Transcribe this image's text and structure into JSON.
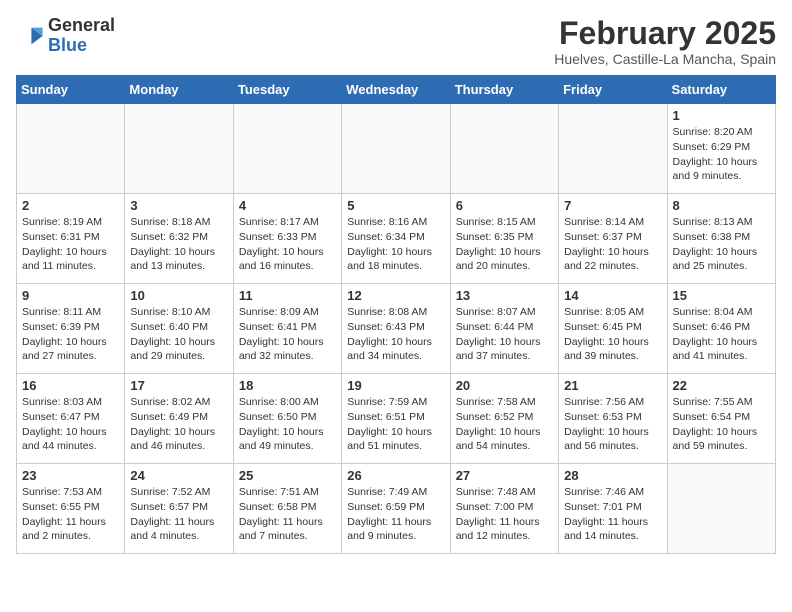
{
  "header": {
    "logo_general": "General",
    "logo_blue": "Blue",
    "month_title": "February 2025",
    "location": "Huelves, Castille-La Mancha, Spain"
  },
  "days_of_week": [
    "Sunday",
    "Monday",
    "Tuesday",
    "Wednesday",
    "Thursday",
    "Friday",
    "Saturday"
  ],
  "weeks": [
    [
      {
        "day": "",
        "info": ""
      },
      {
        "day": "",
        "info": ""
      },
      {
        "day": "",
        "info": ""
      },
      {
        "day": "",
        "info": ""
      },
      {
        "day": "",
        "info": ""
      },
      {
        "day": "",
        "info": ""
      },
      {
        "day": "1",
        "info": "Sunrise: 8:20 AM\nSunset: 6:29 PM\nDaylight: 10 hours and 9 minutes."
      }
    ],
    [
      {
        "day": "2",
        "info": "Sunrise: 8:19 AM\nSunset: 6:31 PM\nDaylight: 10 hours and 11 minutes."
      },
      {
        "day": "3",
        "info": "Sunrise: 8:18 AM\nSunset: 6:32 PM\nDaylight: 10 hours and 13 minutes."
      },
      {
        "day": "4",
        "info": "Sunrise: 8:17 AM\nSunset: 6:33 PM\nDaylight: 10 hours and 16 minutes."
      },
      {
        "day": "5",
        "info": "Sunrise: 8:16 AM\nSunset: 6:34 PM\nDaylight: 10 hours and 18 minutes."
      },
      {
        "day": "6",
        "info": "Sunrise: 8:15 AM\nSunset: 6:35 PM\nDaylight: 10 hours and 20 minutes."
      },
      {
        "day": "7",
        "info": "Sunrise: 8:14 AM\nSunset: 6:37 PM\nDaylight: 10 hours and 22 minutes."
      },
      {
        "day": "8",
        "info": "Sunrise: 8:13 AM\nSunset: 6:38 PM\nDaylight: 10 hours and 25 minutes."
      }
    ],
    [
      {
        "day": "9",
        "info": "Sunrise: 8:11 AM\nSunset: 6:39 PM\nDaylight: 10 hours and 27 minutes."
      },
      {
        "day": "10",
        "info": "Sunrise: 8:10 AM\nSunset: 6:40 PM\nDaylight: 10 hours and 29 minutes."
      },
      {
        "day": "11",
        "info": "Sunrise: 8:09 AM\nSunset: 6:41 PM\nDaylight: 10 hours and 32 minutes."
      },
      {
        "day": "12",
        "info": "Sunrise: 8:08 AM\nSunset: 6:43 PM\nDaylight: 10 hours and 34 minutes."
      },
      {
        "day": "13",
        "info": "Sunrise: 8:07 AM\nSunset: 6:44 PM\nDaylight: 10 hours and 37 minutes."
      },
      {
        "day": "14",
        "info": "Sunrise: 8:05 AM\nSunset: 6:45 PM\nDaylight: 10 hours and 39 minutes."
      },
      {
        "day": "15",
        "info": "Sunrise: 8:04 AM\nSunset: 6:46 PM\nDaylight: 10 hours and 41 minutes."
      }
    ],
    [
      {
        "day": "16",
        "info": "Sunrise: 8:03 AM\nSunset: 6:47 PM\nDaylight: 10 hours and 44 minutes."
      },
      {
        "day": "17",
        "info": "Sunrise: 8:02 AM\nSunset: 6:49 PM\nDaylight: 10 hours and 46 minutes."
      },
      {
        "day": "18",
        "info": "Sunrise: 8:00 AM\nSunset: 6:50 PM\nDaylight: 10 hours and 49 minutes."
      },
      {
        "day": "19",
        "info": "Sunrise: 7:59 AM\nSunset: 6:51 PM\nDaylight: 10 hours and 51 minutes."
      },
      {
        "day": "20",
        "info": "Sunrise: 7:58 AM\nSunset: 6:52 PM\nDaylight: 10 hours and 54 minutes."
      },
      {
        "day": "21",
        "info": "Sunrise: 7:56 AM\nSunset: 6:53 PM\nDaylight: 10 hours and 56 minutes."
      },
      {
        "day": "22",
        "info": "Sunrise: 7:55 AM\nSunset: 6:54 PM\nDaylight: 10 hours and 59 minutes."
      }
    ],
    [
      {
        "day": "23",
        "info": "Sunrise: 7:53 AM\nSunset: 6:55 PM\nDaylight: 11 hours and 2 minutes."
      },
      {
        "day": "24",
        "info": "Sunrise: 7:52 AM\nSunset: 6:57 PM\nDaylight: 11 hours and 4 minutes."
      },
      {
        "day": "25",
        "info": "Sunrise: 7:51 AM\nSunset: 6:58 PM\nDaylight: 11 hours and 7 minutes."
      },
      {
        "day": "26",
        "info": "Sunrise: 7:49 AM\nSunset: 6:59 PM\nDaylight: 11 hours and 9 minutes."
      },
      {
        "day": "27",
        "info": "Sunrise: 7:48 AM\nSunset: 7:00 PM\nDaylight: 11 hours and 12 minutes."
      },
      {
        "day": "28",
        "info": "Sunrise: 7:46 AM\nSunset: 7:01 PM\nDaylight: 11 hours and 14 minutes."
      },
      {
        "day": "",
        "info": ""
      }
    ]
  ]
}
